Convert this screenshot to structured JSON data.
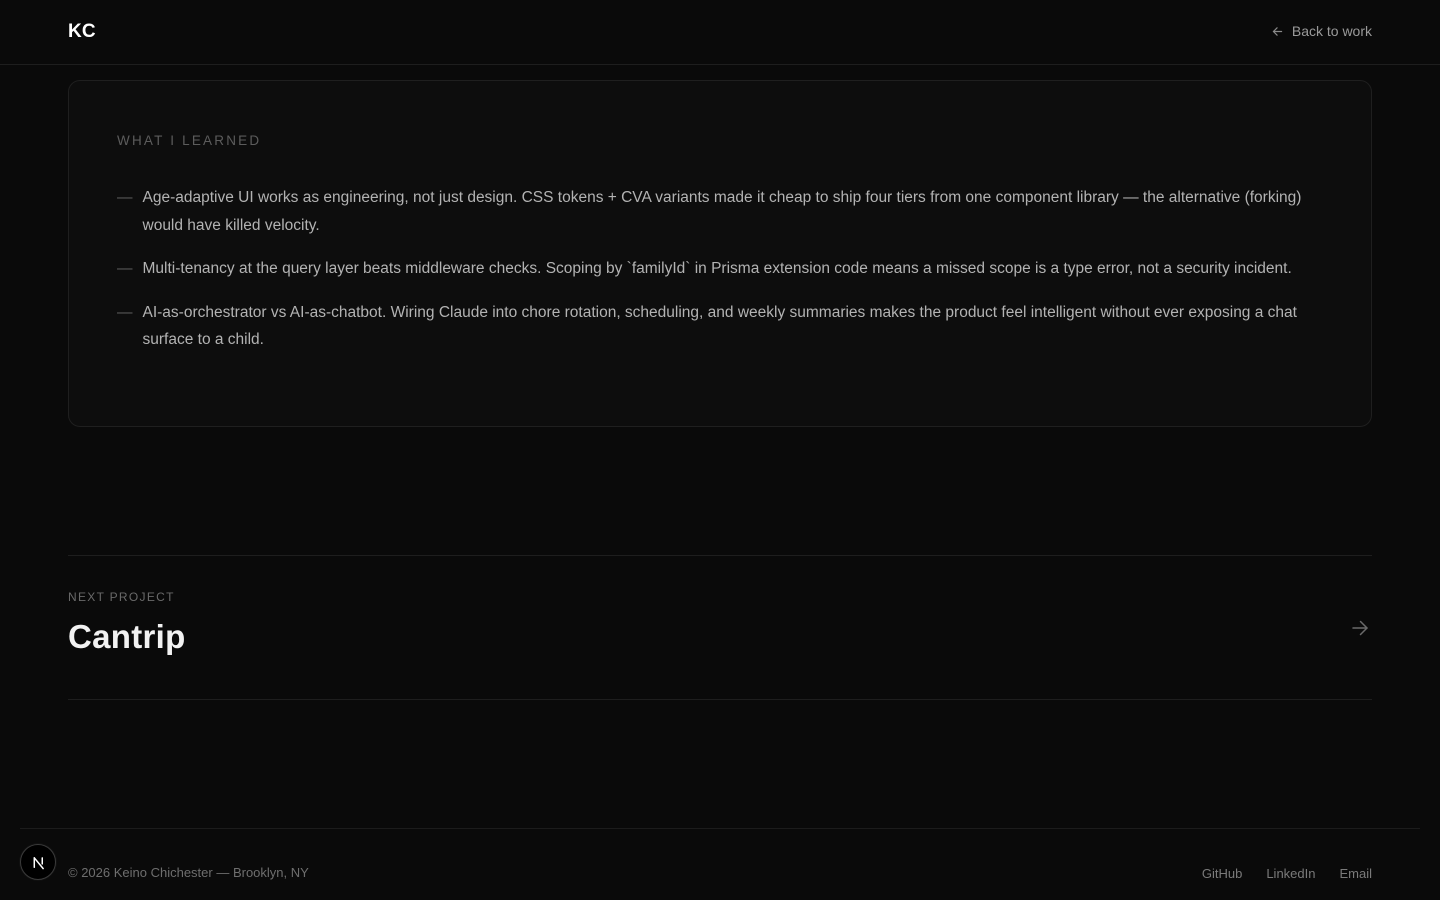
{
  "header": {
    "logo": "KC",
    "back_label": "Back to work"
  },
  "learned": {
    "heading": "WHAT I LEARNED",
    "items": [
      {
        "dash": "—",
        "text": "Age-adaptive UI works as engineering, not just design. CSS tokens + CVA variants made it cheap to ship four tiers from one component library — the alternative (forking) would have killed velocity."
      },
      {
        "dash": "—",
        "text": "Multi-tenancy at the query layer beats middleware checks. Scoping by `familyId` in Prisma extension code means a missed scope is a type error, not a security incident."
      },
      {
        "dash": "—",
        "text": "AI-as-orchestrator vs AI-as-chatbot. Wiring Claude into chore rotation, scheduling, and weekly summaries makes the product feel intelligent without ever exposing a chat surface to a child."
      }
    ]
  },
  "next_project": {
    "label": "NEXT PROJECT",
    "title": "Cantrip",
    "arrow_icon": "arrow-right-icon"
  },
  "footer": {
    "copyright": "© 2026 Keino Chichester — Brooklyn, NY",
    "links": [
      {
        "label": "GitHub"
      },
      {
        "label": "LinkedIn"
      },
      {
        "label": "Email"
      }
    ],
    "badge_icon": "nextjs-n-icon"
  },
  "colors": {
    "background": "#0a0a0a",
    "card": "#0d0d0d",
    "border": "#1f1f1f",
    "text_primary": "#f2f2f2",
    "text_muted": "#b3b3b3"
  }
}
